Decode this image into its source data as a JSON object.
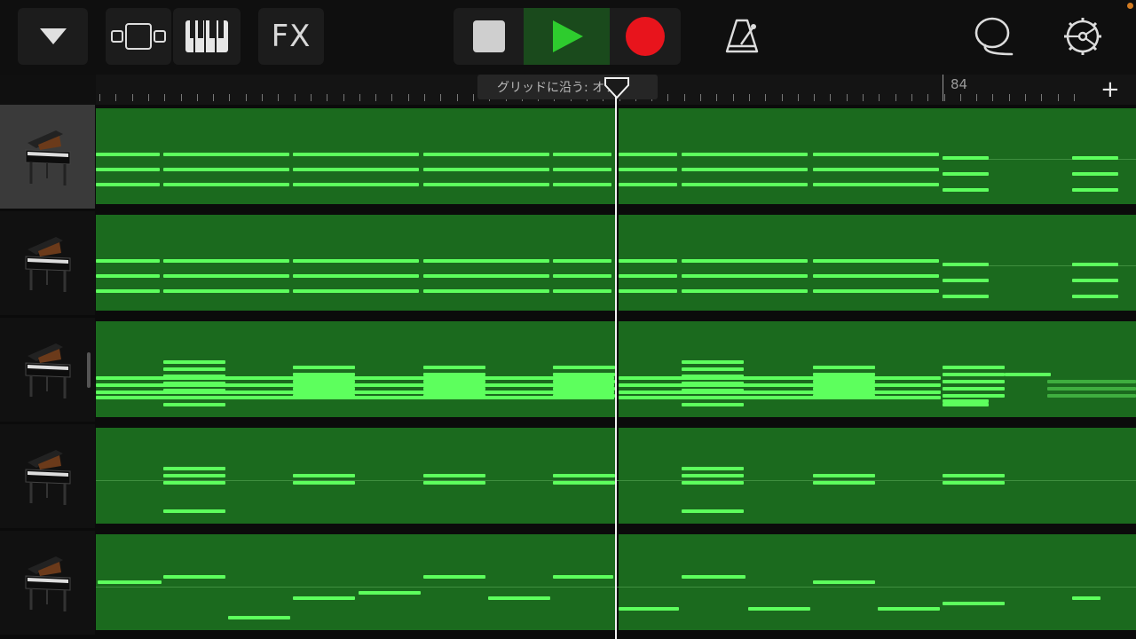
{
  "toolbar": {
    "fx_label": "FX",
    "buttons": [
      "browser-dropdown",
      "tracks-view",
      "instrument-view",
      "fx",
      "stop",
      "play",
      "record",
      "metronome",
      "loop-browser",
      "settings"
    ]
  },
  "colors": {
    "region": "#1b6a1e",
    "note": "#5dff5d",
    "play": "#2ecc2e",
    "record": "#e8141c"
  },
  "ruler": {
    "bar_label": "84",
    "snap_tooltip": "グリッドに沿う: オフ",
    "add_label": "+"
  },
  "tracks": [
    {
      "name": "grand-piano",
      "selected": true
    },
    {
      "name": "grand-piano",
      "selected": false
    },
    {
      "name": "grand-piano",
      "selected": false
    },
    {
      "name": "grand-piano",
      "selected": false
    },
    {
      "name": "grand-piano",
      "selected": false
    }
  ]
}
